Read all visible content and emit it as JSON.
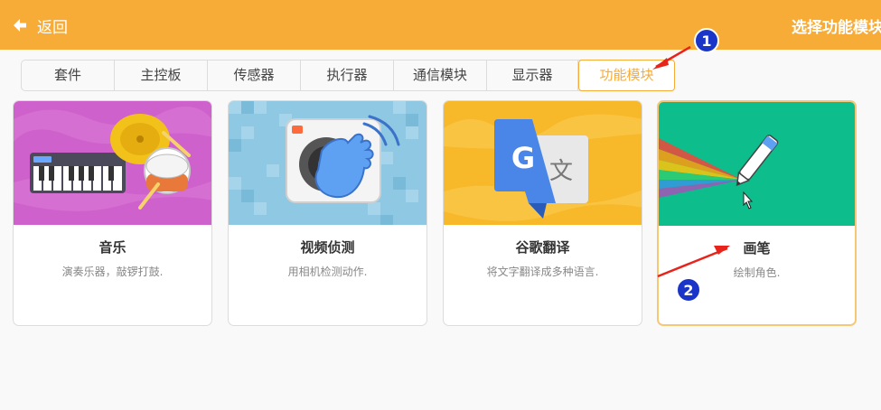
{
  "header": {
    "back_label": "返回",
    "title": "选择功能模块"
  },
  "tabs": [
    {
      "label": "套件",
      "active": false
    },
    {
      "label": "主控板",
      "active": false
    },
    {
      "label": "传感器",
      "active": false
    },
    {
      "label": "执行器",
      "active": false
    },
    {
      "label": "通信模块",
      "active": false
    },
    {
      "label": "显示器",
      "active": false
    },
    {
      "label": "功能模块",
      "active": true
    }
  ],
  "cards": [
    {
      "name": "音乐",
      "desc": "演奏乐器，敲锣打鼓.",
      "icon": "music-icon",
      "bg": "#cf61cc"
    },
    {
      "name": "视频侦测",
      "desc": "用相机检测动作.",
      "icon": "video-sensing-icon",
      "bg": "#8fc8e3"
    },
    {
      "name": "谷歌翻译",
      "desc": "将文字翻译成多种语言.",
      "icon": "translate-icon",
      "bg": "#f7b829"
    },
    {
      "name": "画笔",
      "desc": "绘制角色.",
      "icon": "pen-icon",
      "bg": "#0ebd8c"
    }
  ],
  "annotations": {
    "marker_1": "1",
    "marker_2": "2"
  },
  "colors": {
    "accent": "#f7ac38",
    "annotation_red": "#e8231b",
    "marker_blue": "#1a35c7"
  }
}
